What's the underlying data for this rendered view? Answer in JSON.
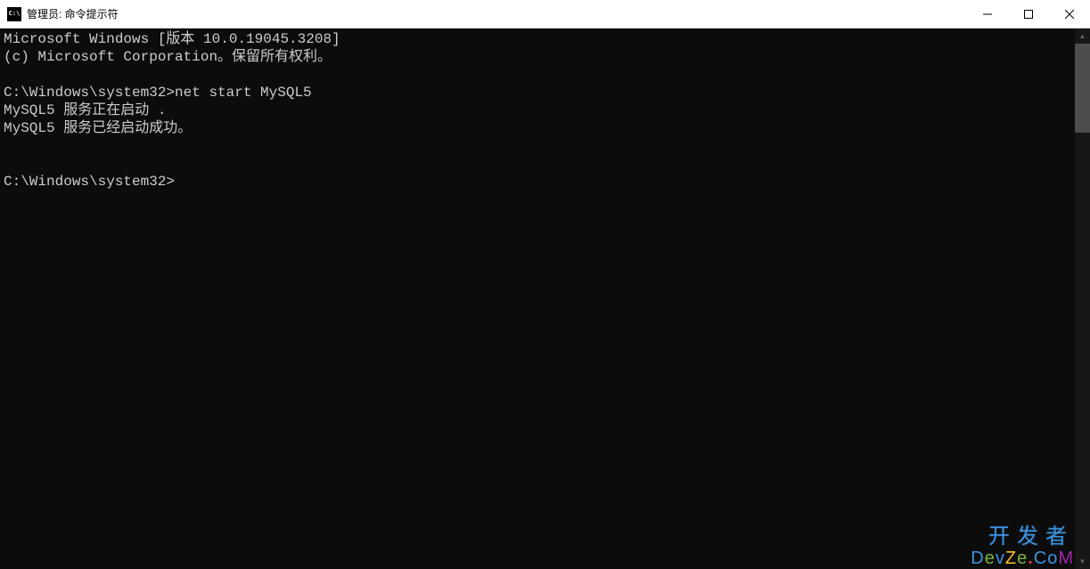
{
  "window": {
    "title": "管理员: 命令提示符"
  },
  "terminal": {
    "lines": [
      "Microsoft Windows [版本 10.0.19045.3208]",
      "(c) Microsoft Corporation。保留所有权利。",
      "",
      "C:\\Windows\\system32>net start MySQL5",
      "MySQL5 服务正在启动 .",
      "MySQL5 服务已经启动成功。",
      "",
      "",
      "C:\\Windows\\system32>"
    ]
  },
  "watermark": {
    "line1": "开发者",
    "line2": "DevZe.CoM"
  }
}
